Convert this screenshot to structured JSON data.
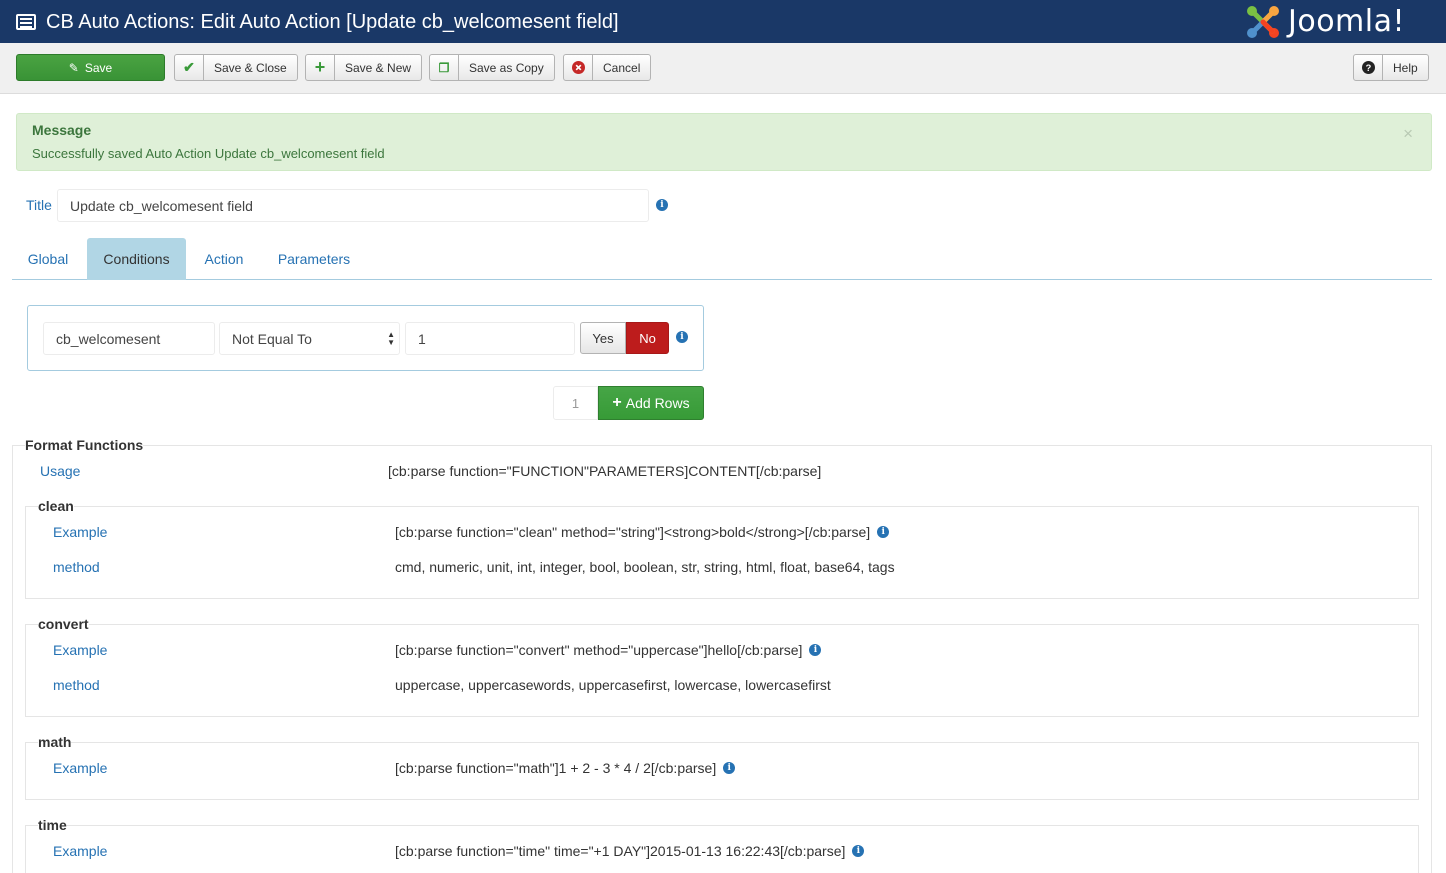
{
  "header": {
    "title": "CB Auto Actions: Edit Auto Action [Update cb_welcomesent field]",
    "logo_text": "Joomla!"
  },
  "toolbar": {
    "save": "Save",
    "save_close": "Save & Close",
    "save_new": "Save & New",
    "save_copy": "Save as Copy",
    "cancel": "Cancel",
    "help": "Help"
  },
  "message": {
    "heading": "Message",
    "body": "Successfully saved Auto Action Update cb_welcomesent field",
    "close": "×"
  },
  "title_field": {
    "label": "Title",
    "value": "Update cb_welcomesent field"
  },
  "tabs": [
    "Global",
    "Conditions",
    "Action",
    "Parameters"
  ],
  "conditions": {
    "field": "cb_welcomesent",
    "operator": "Not Equal To",
    "value": "1",
    "yes": "Yes",
    "no": "No",
    "row_count": "1",
    "add_rows": "Add Rows"
  },
  "format_functions": {
    "legend": "Format Functions",
    "usage_label": "Usage",
    "usage_value": "[cb:parse function=\"FUNCTION\"PARAMETERS]CONTENT[/cb:parse]",
    "groups": [
      {
        "name": "clean",
        "example_label": "Example",
        "example": "[cb:parse function=\"clean\" method=\"string\"]<strong>bold</strong>[/cb:parse]",
        "method_label": "method",
        "method": "cmd, numeric, unit, int, integer, bool, boolean, str, string, html, float, base64, tags"
      },
      {
        "name": "convert",
        "example_label": "Example",
        "example": "[cb:parse function=\"convert\" method=\"uppercase\"]hello[/cb:parse]",
        "method_label": "method",
        "method": "uppercase, uppercasewords, uppercasefirst, lowercase, lowercasefirst"
      },
      {
        "name": "math",
        "example_label": "Example",
        "example": "[cb:parse function=\"math\"]1 + 2 - 3 * 4 / 2[/cb:parse]"
      },
      {
        "name": "time",
        "example_label": "Example",
        "example": "[cb:parse function=\"time\" time=\"+1 DAY\"]2015-01-13 16:22:43[/cb:parse]"
      }
    ]
  },
  "colors": {
    "header_bg": "#1a3867",
    "link_blue": "#2672b3",
    "save_green": "#4aa342",
    "no_red": "#bd1c1c",
    "alert_bg": "#dff0d8"
  },
  "icons": {
    "page": "list-icon",
    "save": "edit-icon",
    "save_close": "check-icon",
    "save_new": "plus-icon",
    "save_copy": "copy-icon",
    "cancel": "cancel-circle-icon",
    "help": "question-icon",
    "info": "info-icon"
  }
}
